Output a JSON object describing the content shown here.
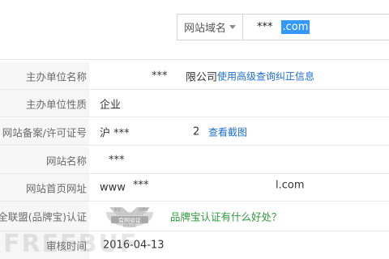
{
  "search": {
    "type_label": "网站域名",
    "query_prefix": "***",
    "query_selected": ".com"
  },
  "rows": [
    {
      "label": "主办单位名称",
      "value_a": "***",
      "value_b": "限公司",
      "link": "使用高级查询纠正信息"
    },
    {
      "label": "主办单位性质",
      "value_a": "企业"
    },
    {
      "label": "网站备案/许可证号",
      "value_a": "沪 ***",
      "value_b": "2",
      "link": "查看截图"
    },
    {
      "label": "网站名称",
      "value_a": "***"
    },
    {
      "label": "网站首页网址",
      "value_a": "www",
      "value_b": "***",
      "value_c": "l.com"
    },
    {
      "label": "安全联盟(品牌宝)认证",
      "badge_text": "官网验证",
      "badge_top": "安全",
      "badge_sub": "品牌宝",
      "badge_bottom": "信息认证",
      "link": "品牌宝认证有什么好处？"
    },
    {
      "label": "审核时间",
      "value_a": "2016-04-13"
    }
  ],
  "watermark": "FREEBUF",
  "colors": {
    "link_blue": "#1f6fd6",
    "link_green": "#2f9b3b",
    "selection": "#3399ff",
    "label_bg": "#f6f6f7"
  }
}
